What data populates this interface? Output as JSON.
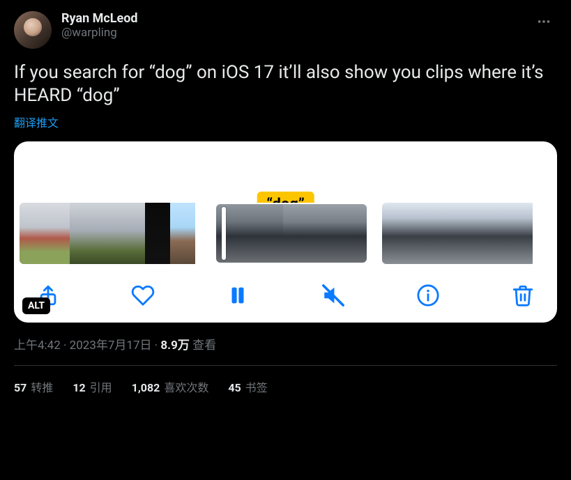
{
  "header": {
    "display_name": "Ryan McLeod",
    "handle": "@warpling"
  },
  "body": "If you search for “dog” on iOS 17 it’ll also show you clips where it’s HEARD “dog”",
  "translate_label": "翻译推文",
  "media": {
    "callout": "“dog”",
    "alt_badge": "ALT"
  },
  "meta": {
    "time": "上午4:42",
    "sep1": " · ",
    "date": "2023年7月17日",
    "sep2": " · ",
    "views_value": "8.9万",
    "views_label": " 查看"
  },
  "stats": {
    "retweets_num": "57",
    "retweets_label": " 转推",
    "quotes_num": "12",
    "quotes_label": " 引用",
    "likes_num": "1,082",
    "likes_label": " 喜欢次数",
    "bookmarks_num": "45",
    "bookmarks_label": " 书签"
  }
}
